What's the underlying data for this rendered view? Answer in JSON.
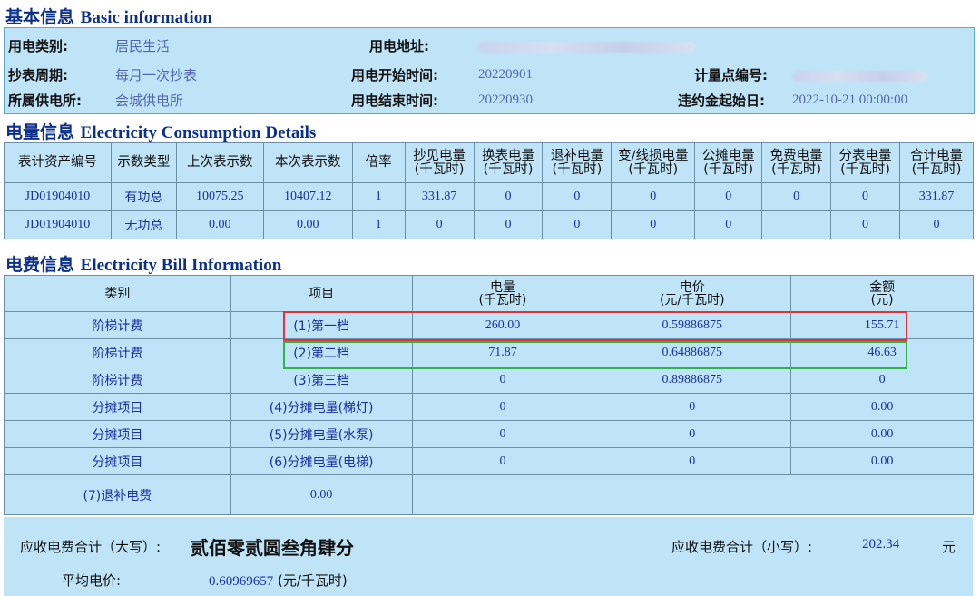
{
  "basic": {
    "title_cn": "基本信息",
    "title_en": "Basic information",
    "category_label": "用电类别:",
    "category_value": "居民生活",
    "address_label": "用电地址:",
    "period_label": "抄表周期:",
    "period_value": "每月一次抄表",
    "start_label": "用电开始时间:",
    "start_value": "20220901",
    "meter_point_label": "计量点编号:",
    "station_label": "所属供电所:",
    "station_value": "会城供电所",
    "end_label": "用电结束时间:",
    "end_value": "20220930",
    "penalty_label": "违约金起始日:",
    "penalty_value": "2022-10-21 00:00:00"
  },
  "consumption": {
    "title_cn": "电量信息",
    "title_en": "Electricity Consumption Details",
    "headers": [
      [
        "表计资产编号"
      ],
      [
        "示数类型"
      ],
      [
        "上次表示数"
      ],
      [
        "本次表示数"
      ],
      [
        "倍率"
      ],
      [
        "抄见电量",
        "(千瓦时)"
      ],
      [
        "换表电量",
        "(千瓦时)"
      ],
      [
        "退补电量",
        "(千瓦时)"
      ],
      [
        "变/线损电量",
        "(千瓦时)"
      ],
      [
        "公摊电量",
        "(千瓦时)"
      ],
      [
        "免费电量",
        "(千瓦时)"
      ],
      [
        "分表电量",
        "(千瓦时)"
      ],
      [
        "合计电量",
        "(千瓦时)"
      ]
    ],
    "rows": [
      [
        "JD01904010",
        "有功总",
        "10075.25",
        "10407.12",
        "1",
        "331.87",
        "0",
        "0",
        "0",
        "0",
        "0",
        "0",
        "331.87"
      ],
      [
        "JD01904010",
        "无功总",
        "0.00",
        "0.00",
        "1",
        "0",
        "0",
        "0",
        "0",
        "0",
        "",
        "0",
        "0"
      ]
    ]
  },
  "bill": {
    "title_cn": "电费信息",
    "title_en": "Electricity Bill Information",
    "headers": [
      [
        "类别"
      ],
      [
        "项目"
      ],
      [
        "电量",
        "(千瓦时)"
      ],
      [
        "电价",
        "(元/千瓦时)"
      ],
      [
        "金额",
        "(元)"
      ]
    ],
    "rows": [
      [
        "阶梯计费",
        "(1)第一档",
        "260.00",
        "0.59886875",
        "155.71"
      ],
      [
        "阶梯计费",
        "(2)第二档",
        "71.87",
        "0.64886875",
        "46.63"
      ],
      [
        "阶梯计费",
        "(3)第三档",
        "0",
        "0.89886875",
        "0"
      ],
      [
        "分摊项目",
        "(4)分摊电量(梯灯)",
        "0",
        "0",
        "0.00"
      ],
      [
        "分摊项目",
        "(5)分摊电量(水泵)",
        "0",
        "0",
        "0.00"
      ],
      [
        "分摊项目",
        "(6)分摊电量(电梯)",
        "0",
        "0",
        "0.00"
      ]
    ],
    "refund_label": "(7)退补电费",
    "refund_value": "0.00"
  },
  "summary": {
    "total_upper_label": "应收电费合计（大写）:",
    "total_upper_value": "贰佰零贰圆叁角肆分",
    "total_lower_label": "应收电费合计（小写）:",
    "total_lower_value": "202.34",
    "currency": "元",
    "avg_label": "平均电价:",
    "avg_value": "0.60969657",
    "avg_unit": "(元/千瓦时)"
  },
  "highlight_colors": {
    "first_tier": "#e5323a",
    "second_tier": "#2fb34a"
  }
}
